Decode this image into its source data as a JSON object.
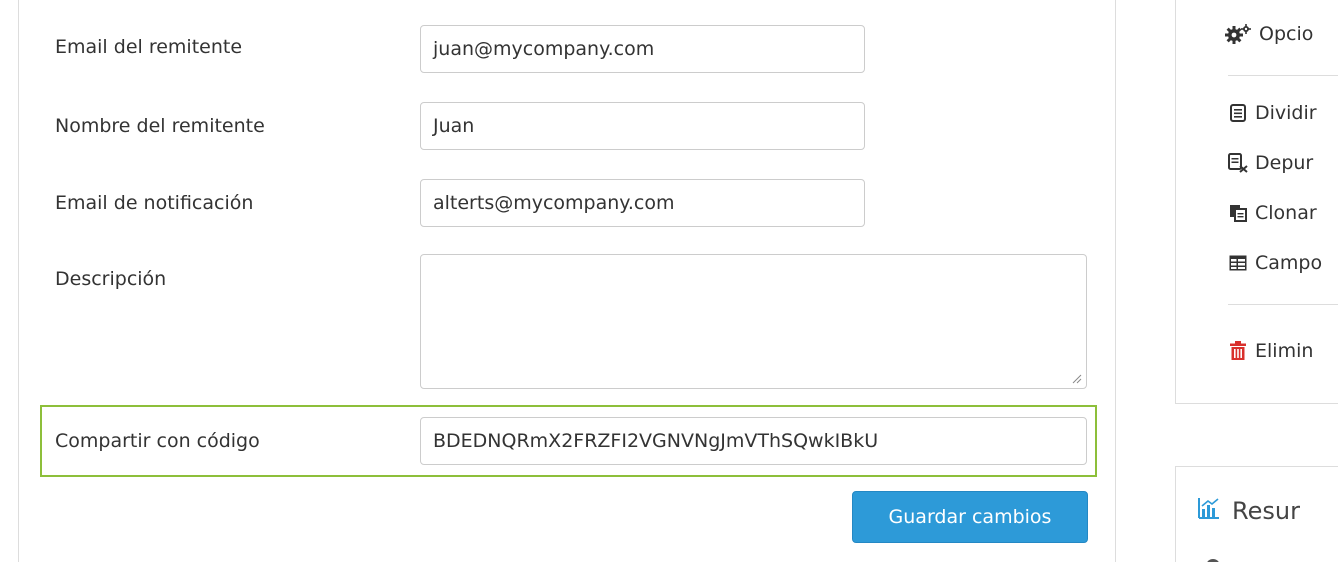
{
  "form": {
    "sender_email": {
      "label": "Email del remitente",
      "value": "juan@mycompany.com"
    },
    "sender_name": {
      "label": "Nombre del remitente",
      "value": "Juan"
    },
    "notification_email": {
      "label": "Email de notificación",
      "value": "alterts@mycompany.com"
    },
    "description": {
      "label": "Descripción",
      "value": ""
    },
    "share_code": {
      "label": "Compartir con código",
      "value": "BDEDNQRmX2FRZFI2VGNVNgJmVThSQwkIBkU"
    },
    "save_label": "Guardar cambios"
  },
  "sidebar": {
    "options_label": "Opcio",
    "items": [
      {
        "label": "Dividir",
        "icon": "document-icon"
      },
      {
        "label": "Depur",
        "icon": "document-clean-icon"
      },
      {
        "label": "Clonar",
        "icon": "copy-icon"
      },
      {
        "label": "Campo",
        "icon": "table-icon"
      }
    ],
    "delete_label": "Elimin",
    "summary_label": "Resur"
  },
  "colors": {
    "accent": "#2d9ad8",
    "highlight": "#8dbf3a",
    "danger": "#d9302c"
  }
}
